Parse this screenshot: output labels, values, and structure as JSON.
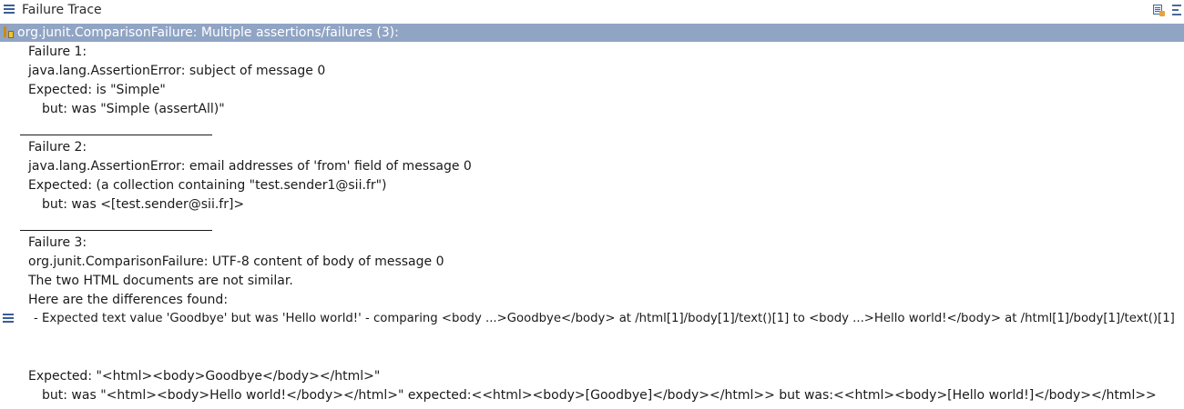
{
  "view": {
    "title": "Failure Trace"
  },
  "trace": {
    "header": "org.junit.ComparisonFailure: Multiple assertions/failures (3):",
    "lines": {
      "f1_title": "Failure 1:",
      "f1_error": "java.lang.AssertionError: subject of message 0",
      "f1_expected": "Expected: is \"Simple\"",
      "f1_but": "but: was \"Simple (assertAll)\"",
      "f2_title": "Failure 2:",
      "f2_error": "java.lang.AssertionError: email addresses of 'from' field of message 0",
      "f2_expected": "Expected: (a collection containing \"test.sender1@sii.fr\")",
      "f2_but": "but: was <[test.sender@sii.fr]>",
      "f3_title": "Failure 3:",
      "f3_error": "org.junit.ComparisonFailure: UTF-8 content of body of message 0",
      "f3_not_similar": "The two HTML documents are not similar.",
      "f3_diff_heading": "Here are the differences found:",
      "f3_diff_item": "- Expected text value 'Goodbye' but was 'Hello world!' - comparing <body ...>Goodbye</body> at /html[1]/body[1]/text()[1] to <body ...>Hello world!</body> at /html[1]/body[1]/text()[1]",
      "f3_expected": "Expected: \"<html><body>Goodbye</body></html>\"",
      "f3_but": "but: was \"<html><body>Hello world!</body></html>\" expected:<<html><body>[Goodbye]</body></html>> but was:<<html><body>[Hello world!]</body></html>>"
    }
  },
  "icons": {
    "title": "list-icon",
    "compare": "compare-results-icon",
    "filter": "filter-stack-trace-icon",
    "failure": "failure-icon",
    "stack_frame": "stack-trace-icon"
  },
  "colors": {
    "selection": "#90a4c4",
    "selection_text": "#ffffff",
    "text": "#1a1a1a",
    "icon_blue": "#3b5e96"
  }
}
